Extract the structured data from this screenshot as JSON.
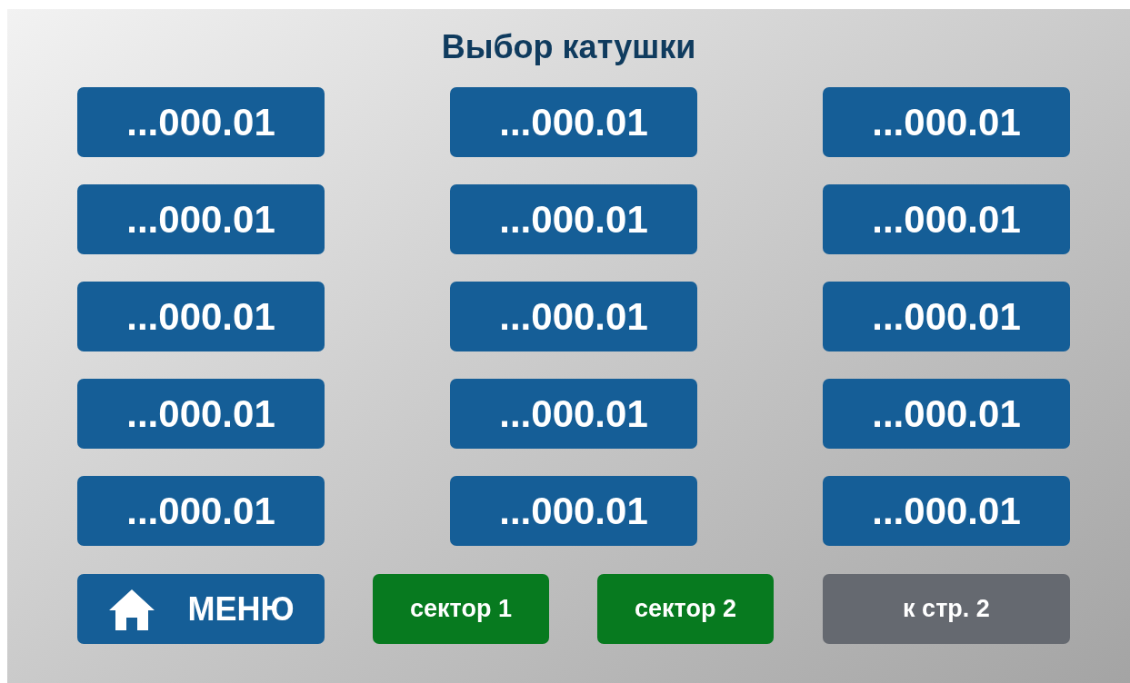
{
  "title": "Выбор катушки",
  "coils": [
    "...000.01",
    "...000.01",
    "...000.01",
    "...000.01",
    "...000.01",
    "...000.01",
    "...000.01",
    "...000.01",
    "...000.01",
    "...000.01",
    "...000.01",
    "...000.01",
    "...000.01",
    "...000.01",
    "...000.01"
  ],
  "footer_buttons": [
    {
      "kind": "menu",
      "label": "МЕНЮ"
    },
    {
      "kind": "sector",
      "label": "сектор 1"
    },
    {
      "kind": "sector",
      "label": "сектор 2"
    },
    {
      "kind": "page",
      "label": "к стр. 2"
    }
  ]
}
